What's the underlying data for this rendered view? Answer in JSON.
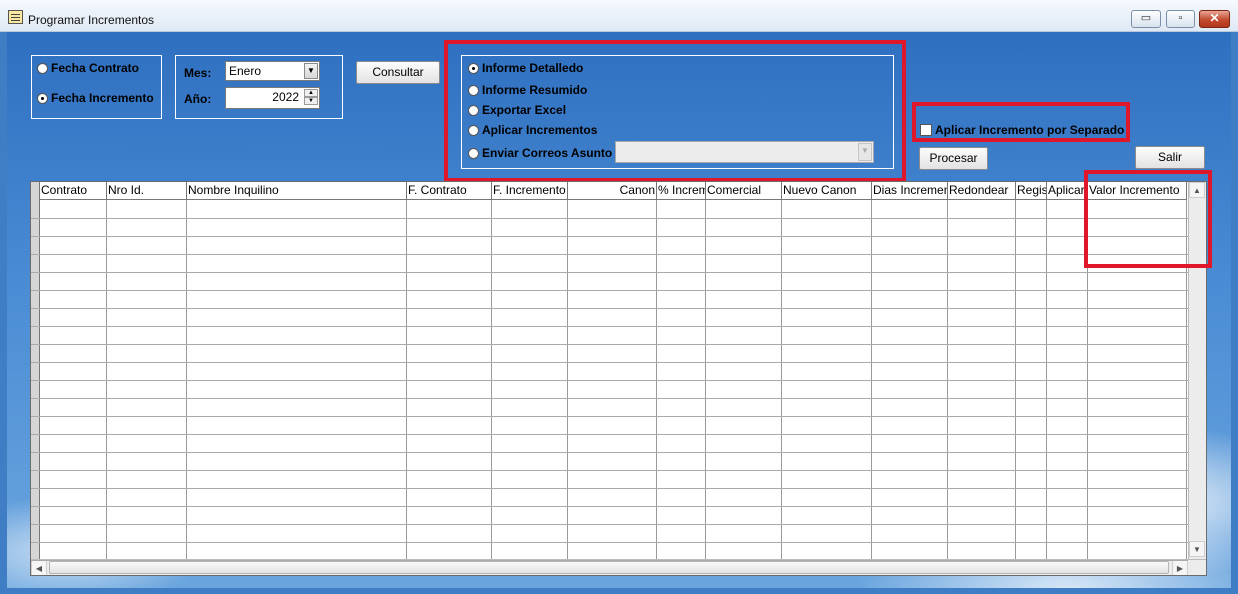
{
  "window": {
    "title": "Programar Incrementos",
    "controls": {
      "minimize": "▭",
      "restore": "▫",
      "close": "✕"
    }
  },
  "date_type": {
    "options": [
      {
        "label": "Fecha Contrato",
        "selected": false
      },
      {
        "label": "Fecha Incremento",
        "selected": true
      }
    ]
  },
  "period": {
    "month_label": "Mes:",
    "month_value": "Enero",
    "year_label": "Año:",
    "year_value": "2022"
  },
  "consult_button": "Consultar",
  "report": {
    "options": [
      {
        "label": "Informe Detalledo",
        "selected": true
      },
      {
        "label": "Informe Resumido",
        "selected": false
      },
      {
        "label": "Exportar Excel",
        "selected": false
      },
      {
        "label": "Aplicar Incrementos",
        "selected": false
      },
      {
        "label": "Enviar Correos Asunto",
        "selected": false
      }
    ],
    "subject_value": ""
  },
  "separate_increment": {
    "label": "Aplicar Incremento por Separado",
    "checked": false
  },
  "process_button": "Procesar",
  "exit_button": "Salir",
  "grid": {
    "columns": [
      "Contrato",
      "Nro Id.",
      "Nombre Inquilino",
      "F. Contrato",
      "F. Incremento",
      "Canon",
      "% Incremento",
      "Comercial",
      "Nuevo Canon",
      "Dias Incremento",
      "Redondear",
      "Registrar",
      "Aplicar",
      "Valor Incremento"
    ],
    "rows": [
      [],
      [],
      [],
      [],
      [],
      [],
      [],
      [],
      [],
      [],
      [],
      [],
      [],
      [],
      [],
      [],
      [],
      [],
      [],
      []
    ]
  },
  "colors": {
    "highlight": "#e0162b",
    "desktop": "#3f7dc4"
  }
}
